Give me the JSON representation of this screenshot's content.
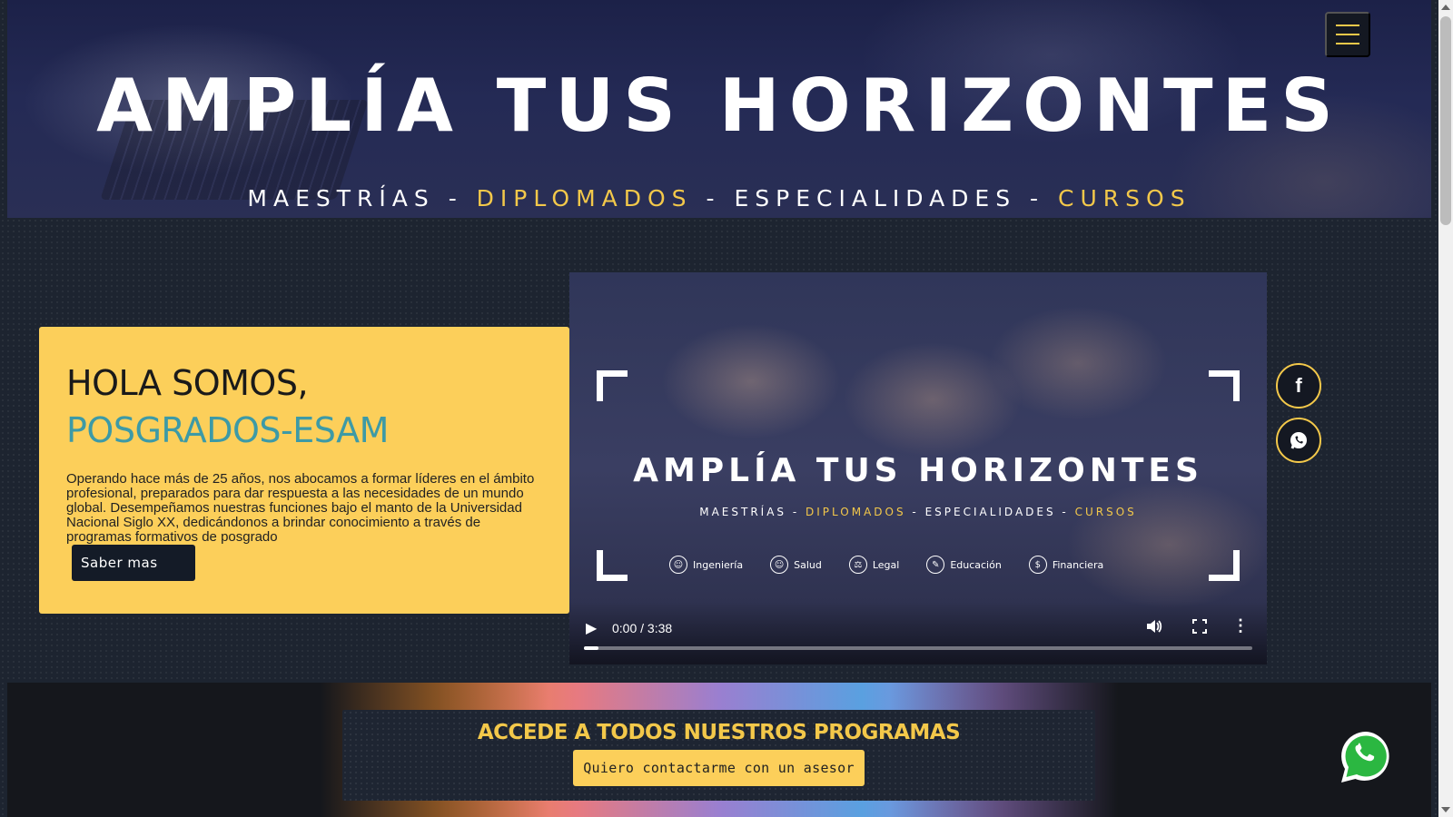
{
  "hero": {
    "title": "AMPLÍA TUS HORIZONTES",
    "sub_1": "MAESTRÍAS",
    "sep_1": " - ",
    "sub_2": "DIPLOMADOS",
    "sep_2": " - ",
    "sub_3": "ESPECIALIDADES",
    "sep_3": " - ",
    "sub_4": "CURSOS"
  },
  "nav": {
    "menu_icon": "hamburger-icon"
  },
  "intro": {
    "heading_1": "HOLA SOMOS,",
    "heading_2": "POSGRADOS-ESAM",
    "body": "Operando hace más de 25 años, nos abocamos a formar líderes en el ámbito profesional, preparados para dar respuesta a las necesidades de un mundo global. Desempeñamos nuestras funciones bajo el manto de la Universidad Nacional Siglo XX, dedicándonos a brindar conocimiento a través de programas formativos de posgrado",
    "button": "Saber mas"
  },
  "video": {
    "title": "AMPLÍA TUS HORIZONTES",
    "sub_1": "MAESTRÍAS",
    "sep_1": " - ",
    "sub_2": "DIPLOMADOS",
    "sep_2": " - ",
    "sub_3": "ESPECIALIDADES",
    "sep_3": " - ",
    "sub_4": "CURSOS",
    "areas": [
      "Ingeniería",
      "Salud",
      "Legal",
      "Educación",
      "Financiera"
    ],
    "time": "0:00 / 3:38",
    "progress": 0.0
  },
  "social": {
    "facebook": "f",
    "whatsapp_icon": "whatsapp-icon"
  },
  "promo": {
    "heading": "ACCEDE A TODOS NUESTROS PROGRAMAS",
    "button": "Quiero contactarme con un asesor"
  },
  "colors": {
    "accent": "#f3c84a",
    "card": "#fccf5a",
    "teal": "#3d9aa6",
    "dark": "#141b27"
  }
}
